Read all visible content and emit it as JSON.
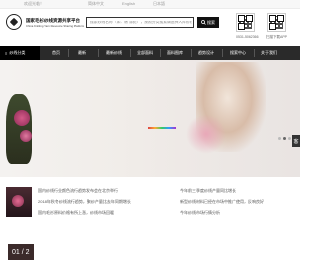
{
  "topbar": {
    "welcome": "欢迎光临！",
    "links": [
      "简体中文",
      "English",
      "日本語"
    ]
  },
  "logo": {
    "title": "国家毛衫纱线资源共享平台",
    "subtitle": "China Knitting Yarn Resource Sharing Platform"
  },
  "search": {
    "placeholder": "搜索纱线名称（如：棉 涤纶），按照分类搜索请选择入库纱线搜索",
    "button_label": "搜索"
  },
  "qr_codes": [
    {
      "caption": "0531-5062366"
    },
    {
      "caption": "扫描下载APP"
    }
  ],
  "nav": {
    "items": [
      "纱线分类",
      "首页",
      "最新",
      "最新纱线",
      "全部面料",
      "面料图库",
      "趋势设计",
      "搜索中心",
      "关于我们"
    ],
    "active_index": 0
  },
  "banner": {
    "slides": 3,
    "active_slide": 1
  },
  "news": {
    "left": [
      "国内纱线行业颜色流行趋势发布会在北京举行",
      "2018年秋冬纱线流行趋势，聚纱产量比去年同期增长",
      "国内毛衫原料价格有所上涨，纱线市场回暖"
    ],
    "right": [
      "今年前三季度纱线产量同比增长",
      "新型纱线材料已经在市场中推广使用，反响良好",
      "今年纱线市场行情分析"
    ]
  },
  "side_button": "客",
  "lower": {
    "date": "01 / 2"
  },
  "colors": {
    "nav_bg": "#2a2a2a",
    "nav_active": "#000000",
    "accent": "#111111"
  }
}
